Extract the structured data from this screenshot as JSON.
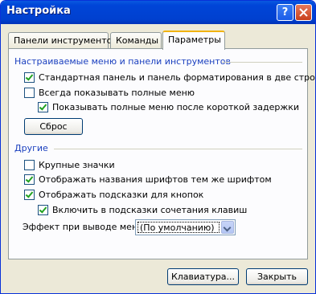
{
  "window": {
    "title": "Настройка",
    "help_label": "?"
  },
  "tabs": [
    {
      "label": "Панели инструментов"
    },
    {
      "label": "Команды"
    },
    {
      "label": "Параметры"
    }
  ],
  "groups": {
    "menus_label": "Настраиваемые меню и панели инструментов",
    "other_label": "Другие"
  },
  "options": {
    "standard_two_rows": {
      "label": "Стандартная панель и панель форматирования в две строки",
      "checked": true
    },
    "always_full_menus": {
      "label": "Всегда показывать полные меню",
      "checked": false
    },
    "full_menus_after_delay": {
      "label": "Показывать полные меню после короткой задержки",
      "checked": true
    },
    "large_icons": {
      "label": "Крупные значки",
      "checked": false
    },
    "font_names_in_font": {
      "label": "Отображать названия шрифтов тем же шрифтом",
      "checked": true
    },
    "show_tooltips": {
      "label": "Отображать подсказки для кнопок",
      "checked": true
    },
    "shortcut_in_tooltips": {
      "label": "Включить в подсказки сочетания клавиш",
      "checked": true
    }
  },
  "reset_label": "Сброс",
  "menu_effect": {
    "label": "Эффект при выводе меню:",
    "value": "(По умолчанию)"
  },
  "footer": {
    "keyboard_label": "Клавиатура...",
    "close_label": "Закрыть"
  }
}
